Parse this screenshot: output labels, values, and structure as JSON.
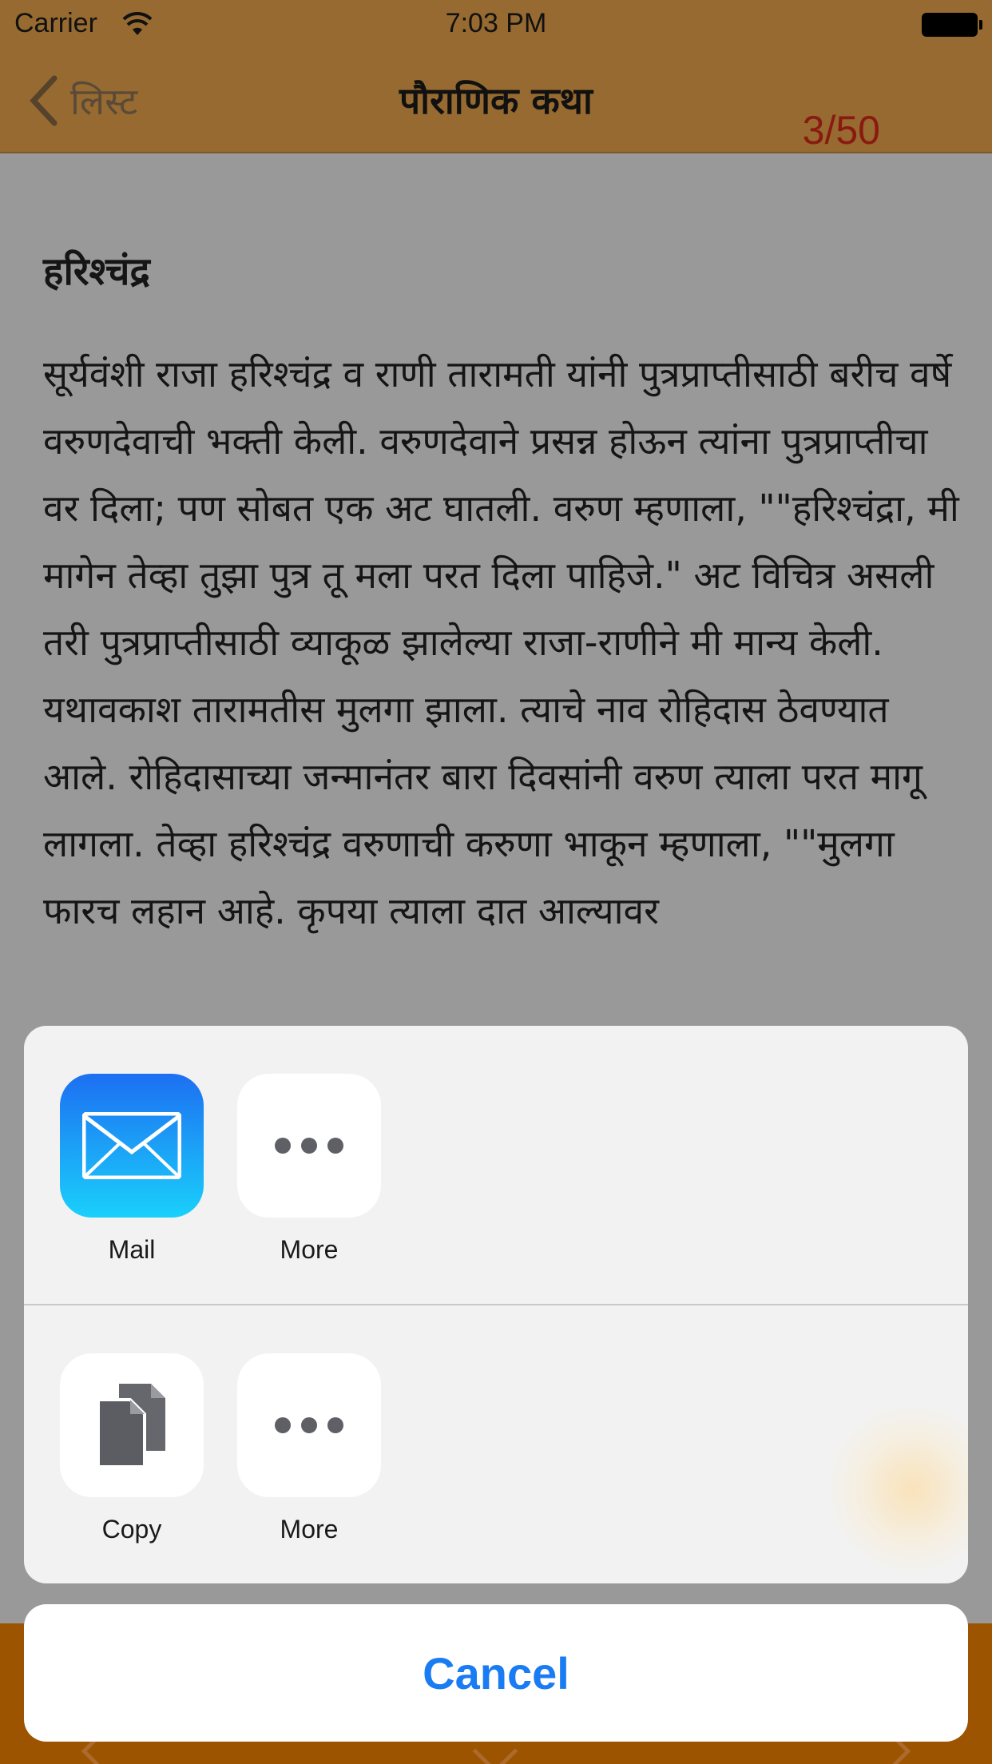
{
  "status_bar": {
    "carrier": "Carrier",
    "time": "7:03 PM"
  },
  "nav": {
    "back_label": "लिस्ट",
    "title": "पौराणिक कथा",
    "counter": "3/50"
  },
  "article": {
    "heading": "हरिश्चंद्र",
    "body": "सूर्यवंशी राजा हरिश्चंद्र व राणी तारामती यांनी पुत्रप्राप्तीसाठी बरीच वर्षे वरुणदेवाची भक्ती केली. वरुणदेवाने प्रसन्न होऊन त्यांना पुत्रप्राप्तीचा वर दिला; पण सोबत एक अट घातली. वरुण म्हणाला, \"\"हरिश्चंद्रा, मी मागेन तेव्हा तुझा पुत्र तू मला परत दिला पाहिजे.\" अट विचित्र असली तरी पुत्रप्राप्तीसाठी व्याकूळ झालेल्या राजा-राणीने मी मान्य केली. यथावकाश तारामतीस मुलगा झाला. त्याचे नाव रोहिदास ठेवण्यात आले. रोहिदासाच्या जन्मानंतर बारा दिवसांनी वरुण त्याला परत मागू लागला. तेव्हा हरिश्चंद्र वरुणाची करुणा भाकून म्हणाला, \"\"मुलगा फारच लहान आहे. कृपया त्याला दात आल्यावर"
  },
  "share_sheet": {
    "share_row": [
      {
        "label": "Mail",
        "icon": "mail-icon"
      },
      {
        "label": "More",
        "icon": "more-icon"
      }
    ],
    "action_row": [
      {
        "label": "Copy",
        "icon": "copy-icon"
      },
      {
        "label": "More",
        "icon": "more-icon"
      }
    ],
    "cancel_label": "Cancel"
  },
  "colors": {
    "nav_bg": "#966a30",
    "toolbar_bg": "#9c5400",
    "counter": "#8a1a10",
    "cancel_text": "#1a7cf3"
  }
}
